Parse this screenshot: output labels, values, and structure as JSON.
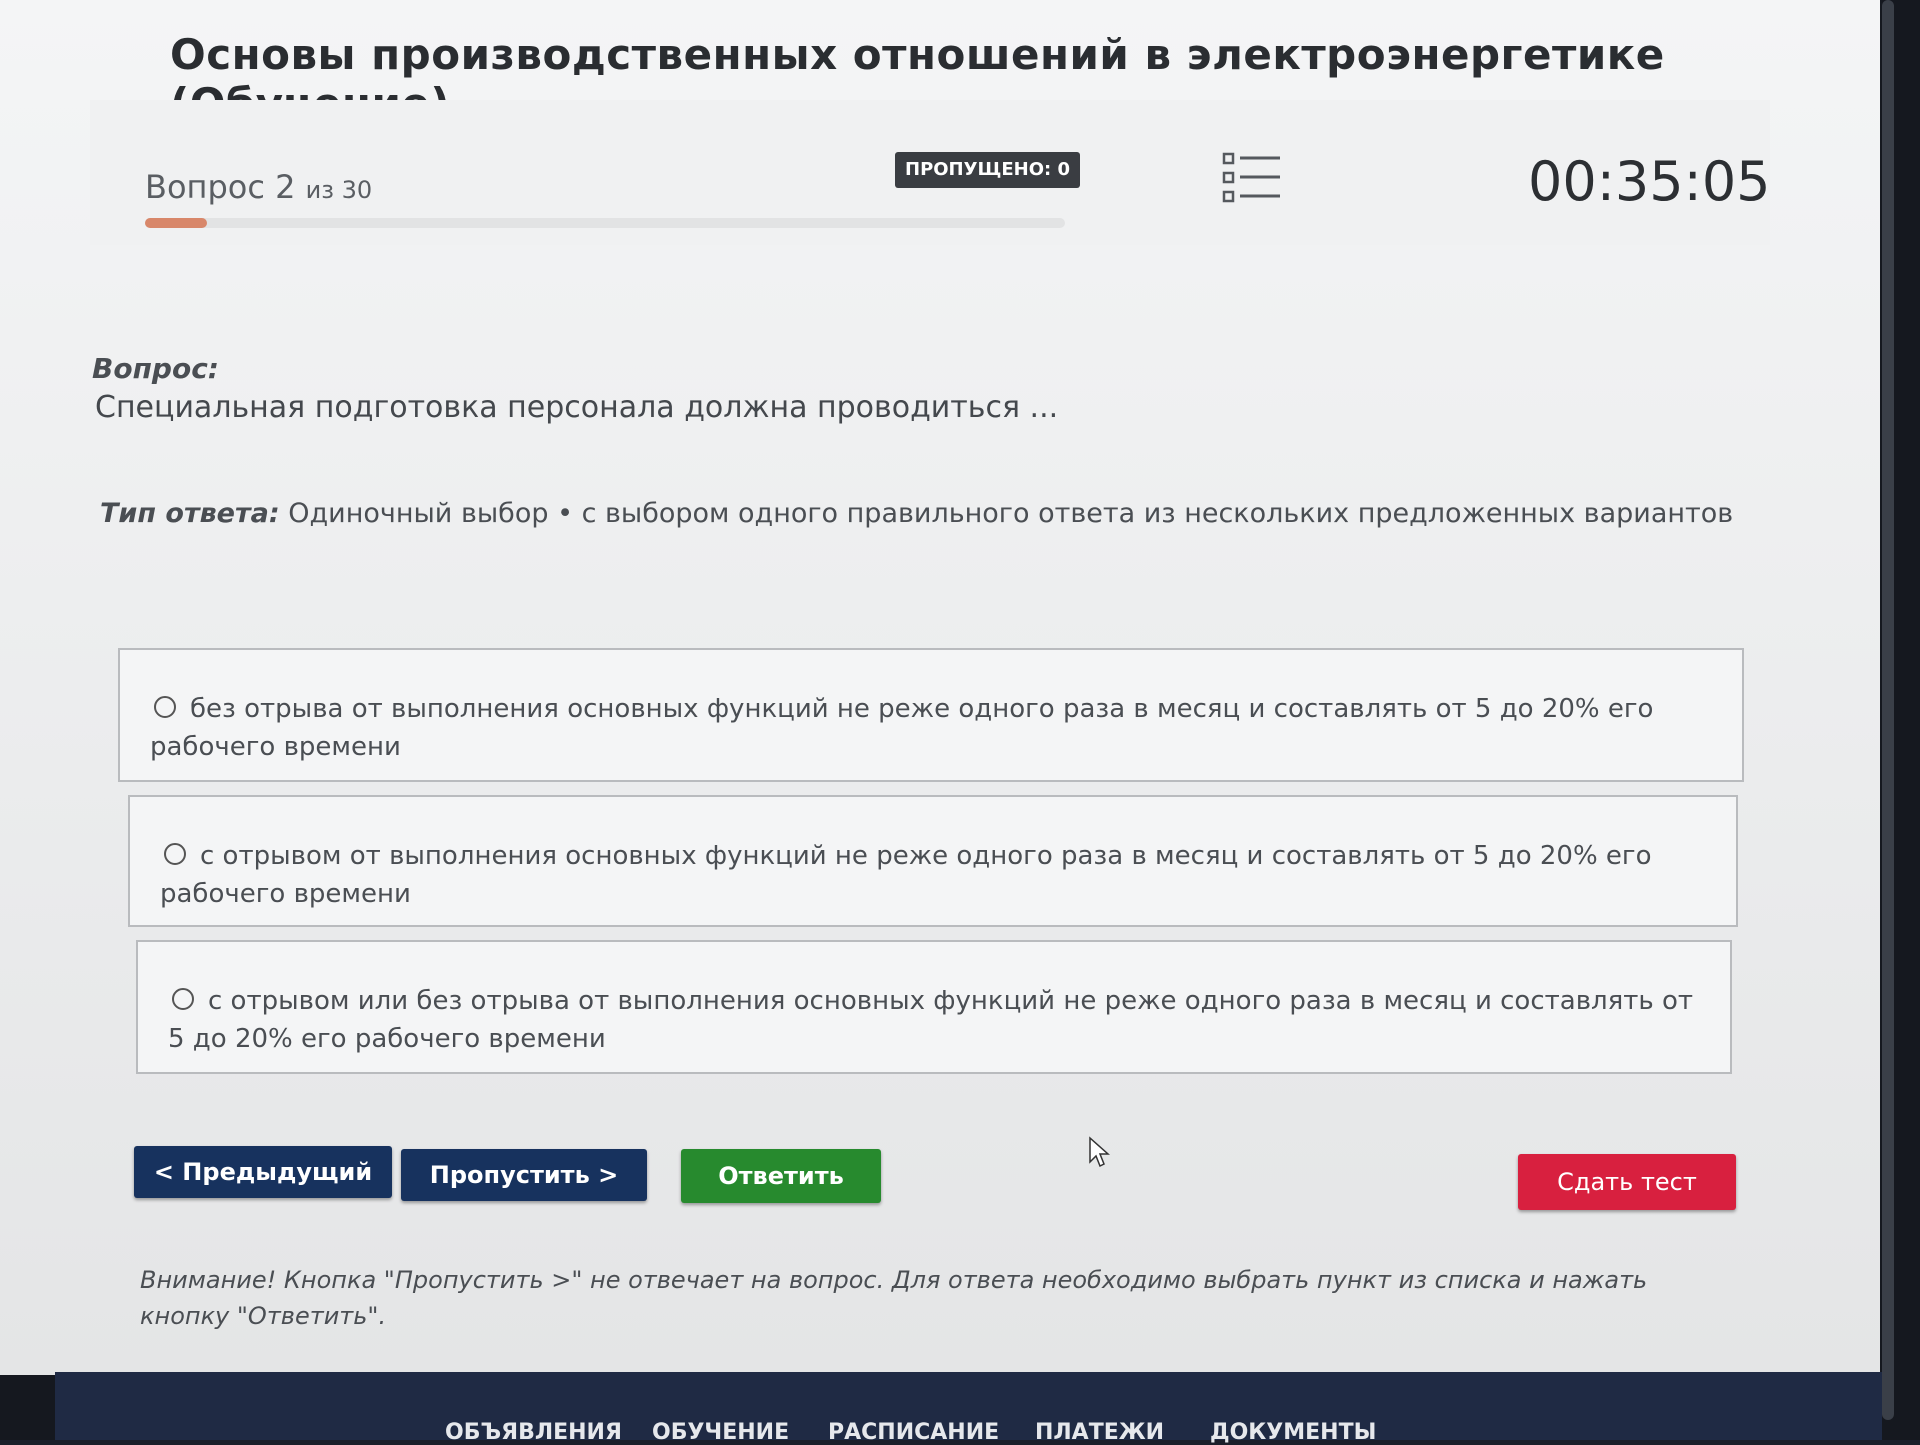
{
  "header": {
    "title": "Основы производственных отношений в электроэнергетике (Обучение)"
  },
  "progress": {
    "question_label": "Вопрос 2",
    "question_total": "из 30",
    "fraction": 0.067,
    "skipped_label": "ПРОПУЩЕНО: 0",
    "timer": "00:35:05",
    "list_icon": "question-list-icon"
  },
  "question": {
    "label": "Вопрос:",
    "text": "Специальная подготовка персонала должна проводиться ...",
    "answer_type_label": "Тип ответа:",
    "answer_type_value": "Одиночный выбор • с выбором одного правильного ответа из нескольких предложенных вариантов"
  },
  "options": [
    {
      "text": "без отрыва от выполнения основных функций не реже одного раза в месяц и составлять от 5 до 20% его рабочего времени"
    },
    {
      "text": "с отрывом от выполнения основных функций не реже одного раза в месяц и составлять от 5 до 20% его рабочего времени"
    },
    {
      "text": "с отрывом или без отрыва от выполнения основных функций не реже одного раза в месяц и составлять от 5 до 20% его рабочего времени"
    }
  ],
  "buttons": {
    "prev": "< Предыдущий",
    "skip": "Пропустить >",
    "answer": "Ответить",
    "submit": "Сдать тест"
  },
  "notice": "Внимание! Кнопка \"Пропустить >\" не отвечает на вопрос. Для ответа необходимо выбрать пункт из списка и нажать кнопку \"Ответить\".",
  "footer": {
    "items": [
      "ОБЪЯВЛЕНИЯ",
      "ОБУЧЕНИЕ",
      "РАСПИСАНИЕ",
      "ПЛАТЕЖИ",
      "ДОКУМЕНТЫ"
    ]
  },
  "colors": {
    "primary_button": "#17325e",
    "answer_button": "#278a2e",
    "submit_button": "#d8203f",
    "progress_fill": "#d8876a"
  }
}
